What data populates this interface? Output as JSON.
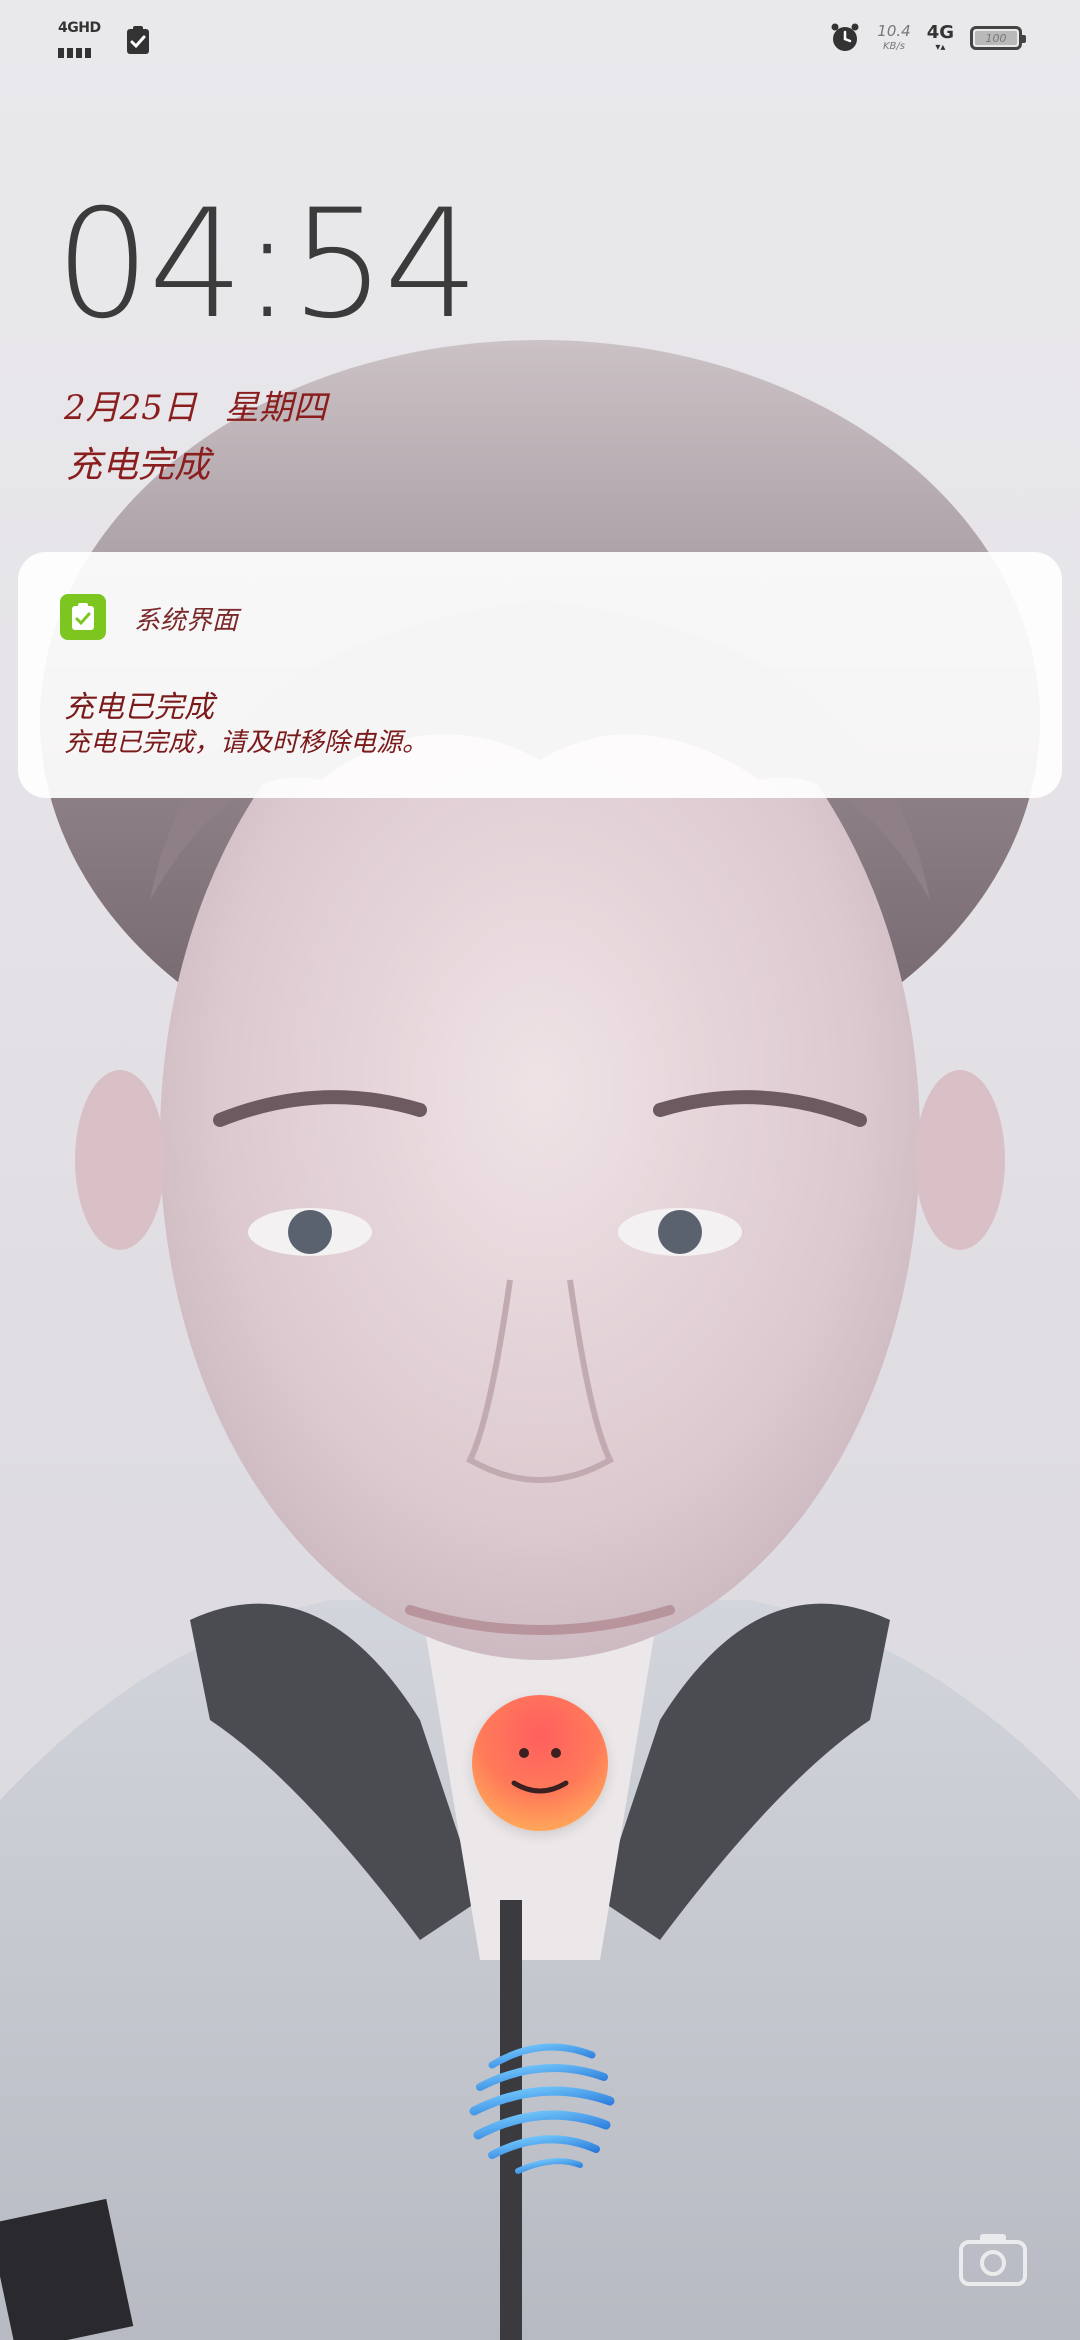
{
  "status_bar": {
    "network_type": "4GHD",
    "net_speed": "10.4",
    "net_speed_unit": "KB/s",
    "mobile_data": "4G",
    "battery_level": "100"
  },
  "lockscreen": {
    "time": "04:54",
    "date": "2月25日",
    "weekday": "星期四",
    "charge_status": "充电完成"
  },
  "notification": {
    "app_name": "系统界面",
    "title": "充电已完成",
    "body": "充电已完成，请及时移除电源。"
  },
  "colors": {
    "date_text": "#8a1e1e",
    "app_icon_bg": "#7cc61f",
    "clock_text": "#3b3b3b"
  }
}
